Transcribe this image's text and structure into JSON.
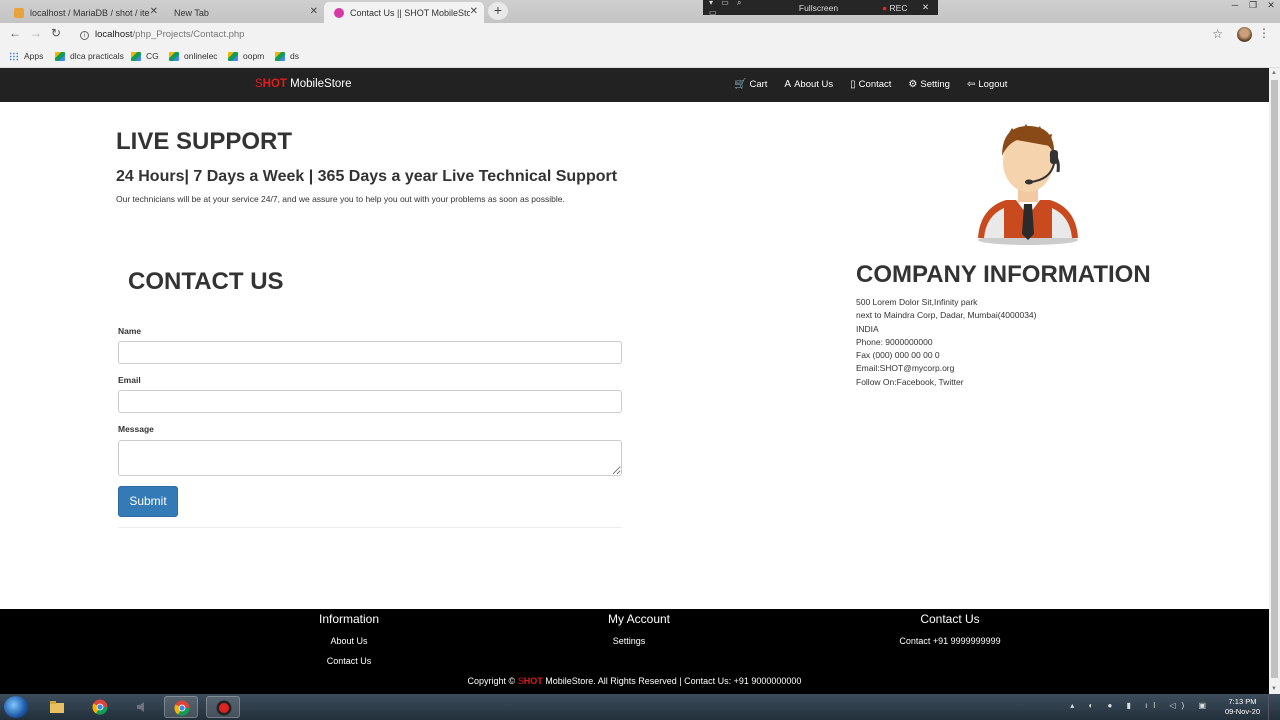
{
  "browser": {
    "tabs": [
      {
        "title": "localhost / MariaDB / shot / item",
        "active": false
      },
      {
        "title": "New Tab",
        "active": false
      },
      {
        "title": "Contact Us || SHOT MobileStore",
        "active": true
      }
    ],
    "new_tab": "+",
    "recorder": {
      "label": "Fullscreen",
      "rec": "REC"
    },
    "url_host": "localhost",
    "url_path": "/php_Projects/Contact.php",
    "bookmarks": [
      "Apps",
      "dlca practicals",
      "CG",
      "onlinelec",
      "oopm",
      "ds"
    ]
  },
  "site": {
    "brand": {
      "s": "S",
      "hot": "HOT",
      "rest": " MobileStore"
    },
    "nav": [
      {
        "icon": "cart-icon",
        "glyph": "🛒",
        "label": "Cart"
      },
      {
        "icon": "font-icon",
        "glyph": "A",
        "label": "About Us"
      },
      {
        "icon": "phone-icon",
        "glyph": "▯",
        "label": "Contact"
      },
      {
        "icon": "gear-icon",
        "glyph": "⚙",
        "label": "Setting"
      },
      {
        "icon": "logout-icon",
        "glyph": "⇦",
        "label": "Logout"
      }
    ]
  },
  "live_support": {
    "title": "LIVE SUPPORT",
    "subtitle": "24 Hours| 7 Days a Week | 365 Days a year Live Technical Support",
    "text": "Our technicians will be at your service 24/7, and we assure you to help you out with your problems as soon as possible."
  },
  "contact_form": {
    "title": "CONTACT US",
    "name_label": "Name",
    "name_value": "",
    "email_label": "Email",
    "email_value": "",
    "message_label": "Message",
    "message_value": "",
    "submit": "Submit"
  },
  "company": {
    "title": "COMPANY INFORMATION",
    "lines": [
      "500 Lorem Dolor Sit,Infinity park",
      "next to Maindra Corp, Dadar, Mumbai(4000034)",
      "INDIA",
      "Phone: 9000000000",
      "Fax (000) 000 00 00 0",
      "Email:SHOT@mycorp.org",
      "Follow On:Facebook, Twitter"
    ]
  },
  "footer": {
    "information": {
      "title": "Information",
      "links": [
        "About Us",
        "Contact Us"
      ]
    },
    "account": {
      "title": "My Account",
      "links": [
        "Settings"
      ]
    },
    "contact": {
      "title": "Contact Us",
      "links": [
        "Contact +91 9999999999"
      ]
    },
    "copyright": {
      "pre": "Copyright © ",
      "s": "S",
      "hot": "HOT",
      "post": " MobileStore. All Rights Reserved | Contact Us: +91 9000000000"
    }
  },
  "taskbar": {
    "time": "7:13 PM",
    "date": "09-Nov-20"
  }
}
